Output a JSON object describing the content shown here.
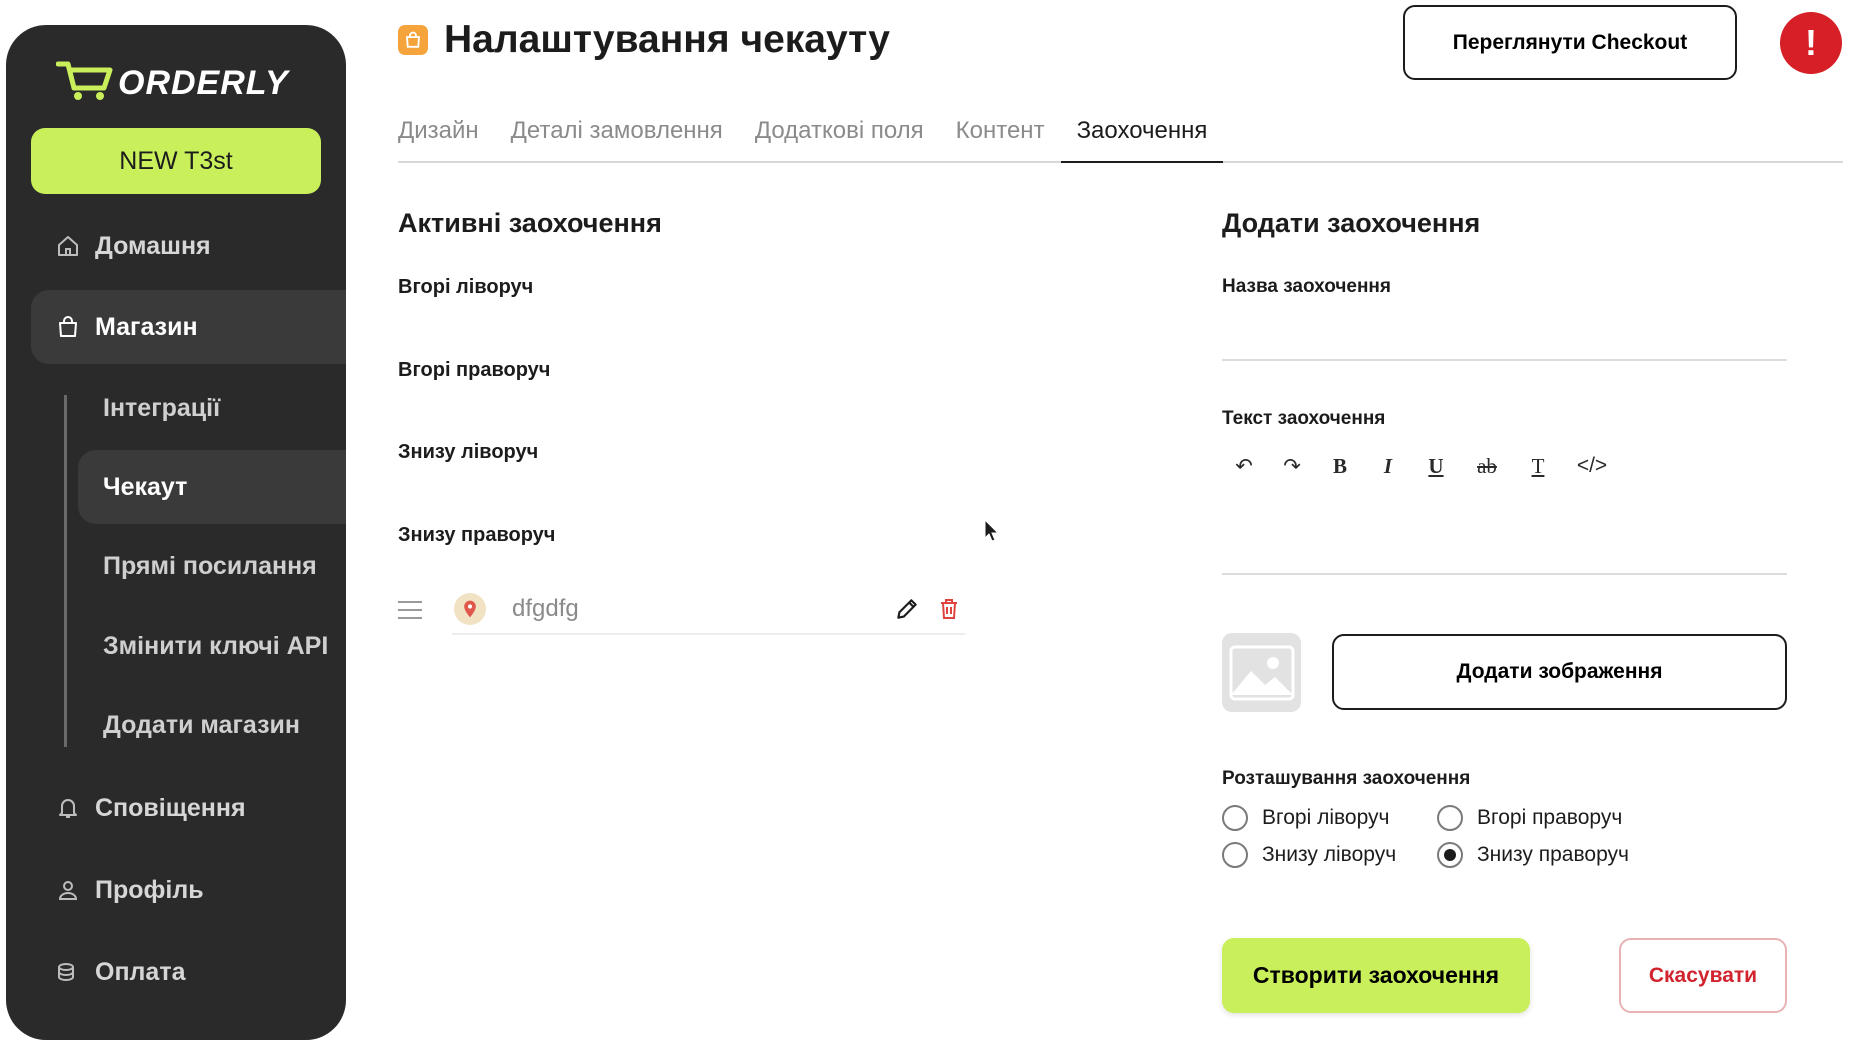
{
  "sidebar": {
    "logo_text": "ORDERLY",
    "store_button": "NEW T3st",
    "nav": {
      "home": "Домашня",
      "store": "Магазин",
      "notifications": "Сповіщення",
      "profile": "Профіль",
      "payment": "Оплата"
    },
    "sub": {
      "integrations": "Інтеграції",
      "checkout": "Чекаут",
      "direct_links": "Прямі посилання",
      "api_keys": "Змінити ключі API",
      "add_store": "Додати магазин"
    }
  },
  "header": {
    "title": "Налаштування чекауту",
    "view_button": "Переглянути Checkout",
    "alert_glyph": "!"
  },
  "tabs": [
    "Дизайн",
    "Деталі замовлення",
    "Додаткові поля",
    "Контент",
    "Заохочення"
  ],
  "active_tab": "Заохочення",
  "active_incentives": {
    "title": "Активні заохочення",
    "positions": [
      "Вгорі ліворуч",
      "Вгорі праворуч",
      "Знизу ліворуч",
      "Знизу праворуч"
    ],
    "items": [
      {
        "name": "dfgdfg",
        "position": "Знизу праворуч"
      }
    ]
  },
  "add_incentive": {
    "title": "Додати заохочення",
    "name_label": "Назва заохочення",
    "name_value": "",
    "text_label": "Текст заохочення",
    "toolbar": {
      "undo": "↶",
      "redo": "↷",
      "bold": "B",
      "italic": "I",
      "underline": "U",
      "strike": "ab",
      "clear": "T",
      "code": "</>"
    },
    "add_image_button": "Додати зображення",
    "position_label": "Розташування заохочення",
    "position_options": [
      "Вгорі ліворуч",
      "Вгорі праворуч",
      "Знизу ліворуч",
      "Знизу праворуч"
    ],
    "selected_position": "Знизу праворуч",
    "create_button": "Створити заохочення",
    "cancel_button": "Скасувати"
  },
  "colors": {
    "accent": "#c9f05b",
    "sidebar_bg": "#2a2a2a",
    "danger": "#d1242f",
    "title_icon": "#f5a33b"
  }
}
